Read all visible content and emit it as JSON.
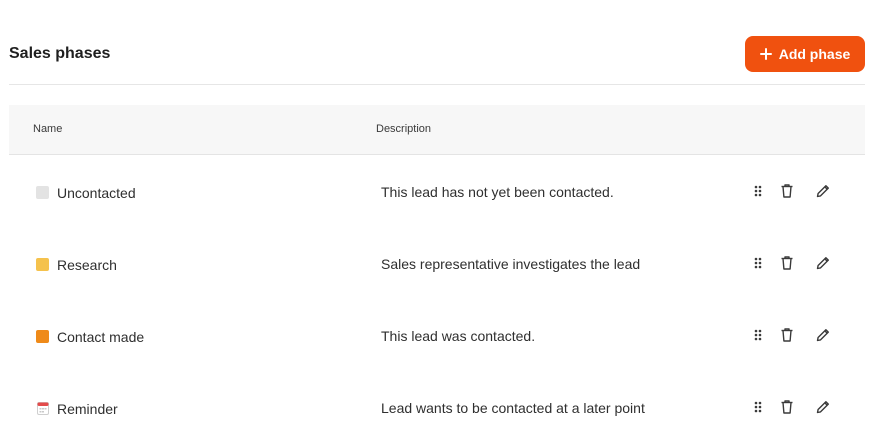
{
  "header": {
    "title": "Sales phases",
    "add_button_label": "Add phase"
  },
  "table": {
    "columns": [
      "Name",
      "Description"
    ],
    "rows": [
      {
        "name": "Uncontacted",
        "description": "This lead has not yet been contacted.",
        "color": "#e3e3e3",
        "icon": "color-swatch"
      },
      {
        "name": "Research",
        "description": "Sales representative investigates the lead",
        "color": "#f5c24d",
        "icon": "color-swatch"
      },
      {
        "name": "Contact made",
        "description": "This lead was contacted.",
        "color": "#ef8a19",
        "icon": "color-swatch"
      },
      {
        "name": "Reminder",
        "description": "Lead wants to be contacted at a later point",
        "color": "#e34b4b",
        "icon": "calendar-icon"
      }
    ],
    "row_actions": [
      "drag-handle-icon",
      "trash-icon",
      "pencil-icon"
    ]
  },
  "colors": {
    "accent": "#f0510f",
    "header_bg": "#f7f7f7",
    "divider": "#e6e6e6"
  }
}
